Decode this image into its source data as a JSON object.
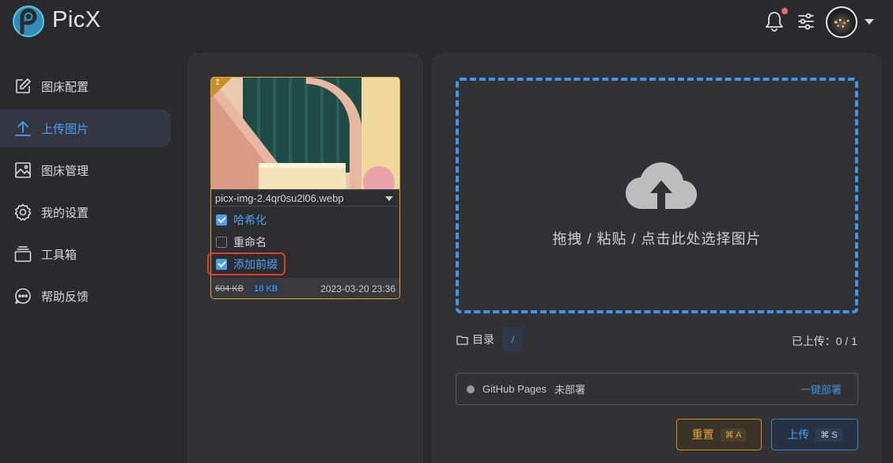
{
  "app": {
    "title": "PicX"
  },
  "header": {
    "notification_icon": "bell-icon",
    "settings_icon": "sliders-icon",
    "menu_icon": "caret-down-icon",
    "notification_dot_color": "#f06b6b"
  },
  "sidebar": {
    "items": [
      {
        "label": "图床配置",
        "icon": "edit-icon",
        "active": false
      },
      {
        "label": "上传图片",
        "icon": "upload-icon",
        "active": true
      },
      {
        "label": "图床管理",
        "icon": "image-icon",
        "active": false
      },
      {
        "label": "我的设置",
        "icon": "gear-icon",
        "active": false
      },
      {
        "label": "工具箱",
        "icon": "toolbox-icon",
        "active": false
      },
      {
        "label": "帮助反馈",
        "icon": "chat-icon",
        "active": false
      }
    ]
  },
  "image_card": {
    "filename": "picx-img-2.4qr0su2l06.webp",
    "options": [
      {
        "label": "哈希化",
        "checked": true
      },
      {
        "label": "重命名",
        "checked": false
      },
      {
        "label": "添加前缀",
        "checked": true
      }
    ],
    "original_size": "604 KB",
    "compressed_size": "18 KB",
    "timestamp": "2023-03-20 23:36"
  },
  "dropzone": {
    "text": "拖拽 / 粘贴 / 点击此处选择图片"
  },
  "directory": {
    "label": "目录",
    "value": "/"
  },
  "upload_count": "已上传：0 / 1",
  "deploy": {
    "name": "GitHub Pages",
    "status": "未部署",
    "action": "一键部署"
  },
  "buttons": {
    "reset": {
      "label": "重置",
      "shortcut": "⌘ A"
    },
    "upload": {
      "label": "上传",
      "shortcut": "⌘ S"
    }
  },
  "colors": {
    "accent": "#4aa0f0",
    "warning": "#e3a53c",
    "highlight": "#e23b2a"
  }
}
